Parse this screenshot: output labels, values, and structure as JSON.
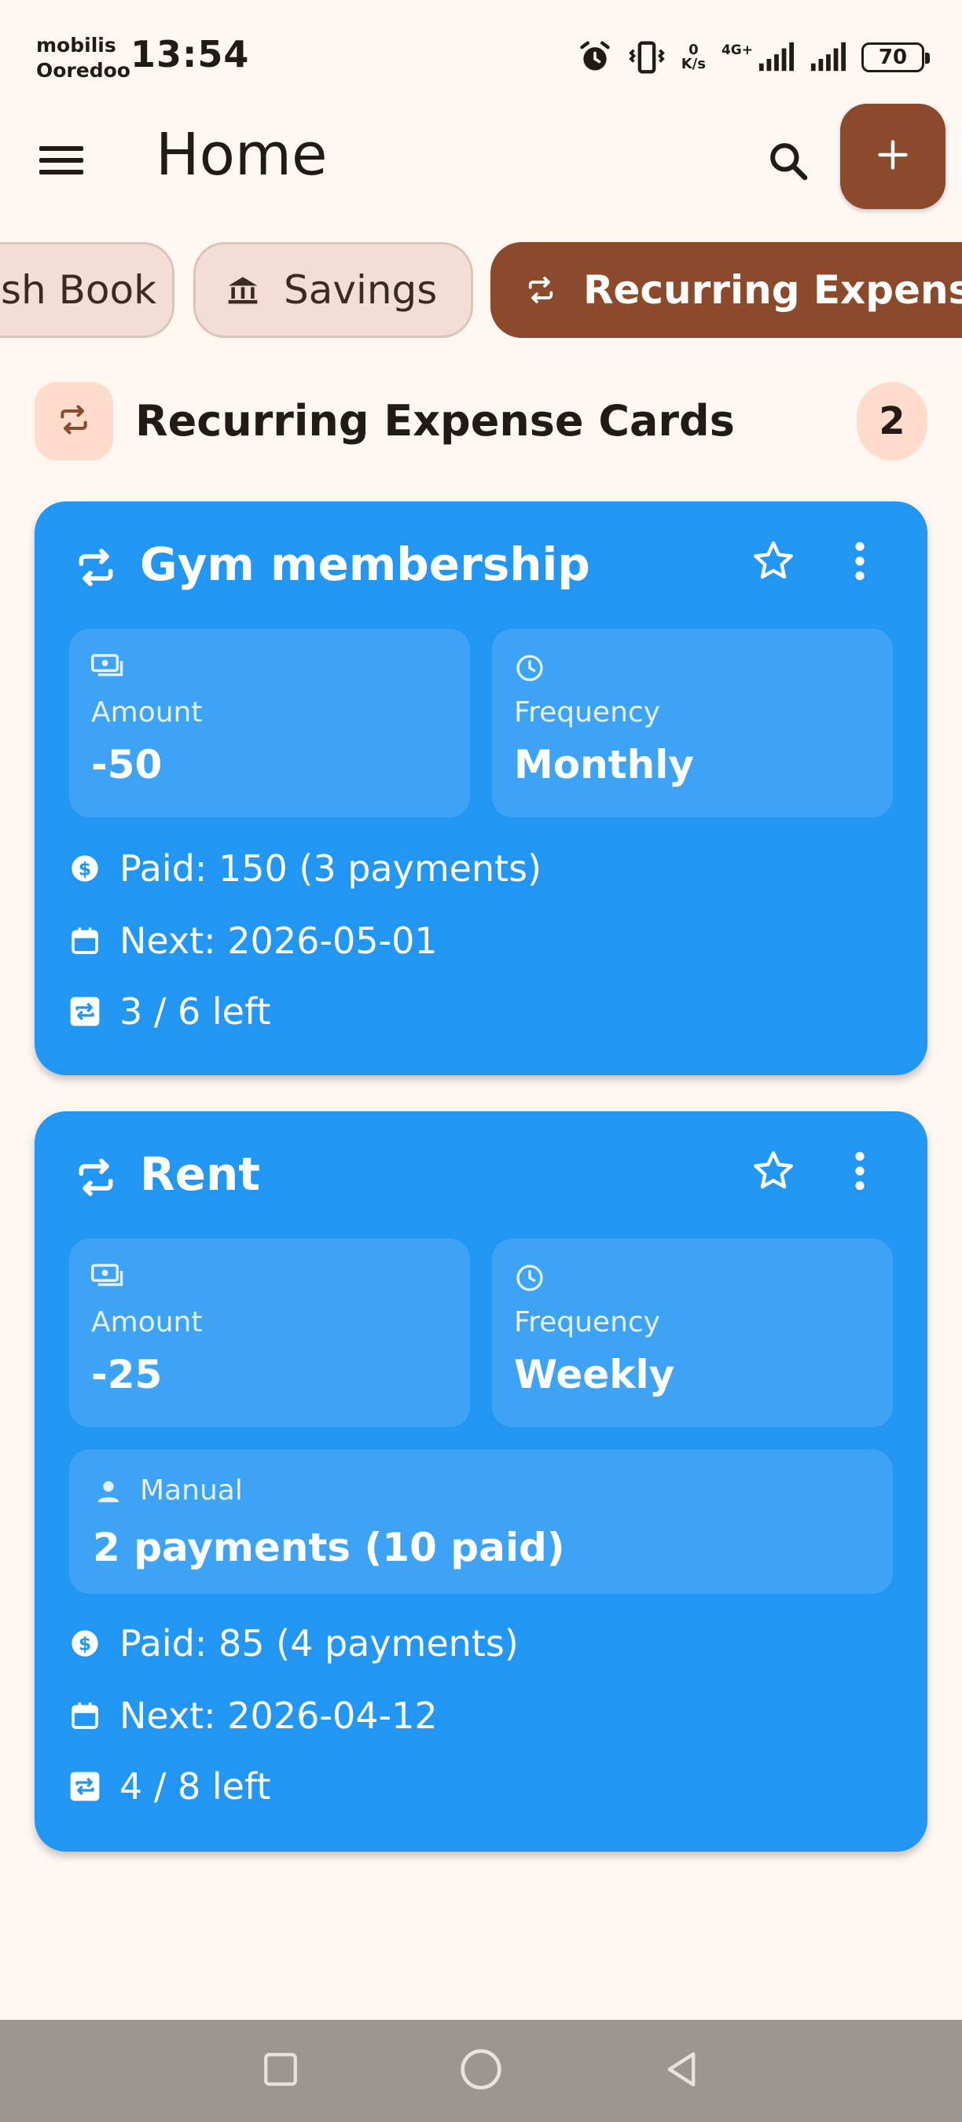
{
  "status_bar": {
    "carrier_line1": "mobilis",
    "carrier_line2": "Ooredoo",
    "time": "13:54",
    "net_speed_value": "0",
    "net_speed_unit": "K/s",
    "network_type": "4G+",
    "battery_level": "70"
  },
  "app_bar": {
    "title": "Home",
    "icons": {
      "menu": "menu-icon",
      "search": "search-icon",
      "add": "plus-icon"
    }
  },
  "tabs": [
    {
      "label": "sh Book",
      "selected": false
    },
    {
      "label": "Savings",
      "icon": "bank-icon",
      "selected": false
    },
    {
      "label": "Recurring Expense",
      "icon": "repeat-icon",
      "selected": true
    }
  ],
  "section": {
    "title": "Recurring Expense Cards",
    "count": "2"
  },
  "cards": [
    {
      "title": "Gym membership",
      "amount_label": "Amount",
      "amount": "-50",
      "frequency_label": "Frequency",
      "frequency": "Monthly",
      "paid": "Paid: 150 (3 payments)",
      "next": "Next: 2026-05-01",
      "left": "3 / 6 left"
    },
    {
      "title": "Rent",
      "amount_label": "Amount",
      "amount": "-25",
      "frequency_label": "Frequency",
      "frequency": "Weekly",
      "manual_label": "Manual",
      "manual_value": "2 payments (10 paid)",
      "paid": "Paid: 85 (4 payments)",
      "next": "Next: 2026-04-12",
      "left": "4 / 8 left"
    }
  ],
  "colors": {
    "background": "#FFF7F2",
    "primary": "#8B4A2B",
    "card": "#2196F3",
    "tile": "#3FA3F5",
    "chip": "#F3DDD4",
    "badge": "#FFDCCB",
    "nav_bar": "#9B9690"
  }
}
